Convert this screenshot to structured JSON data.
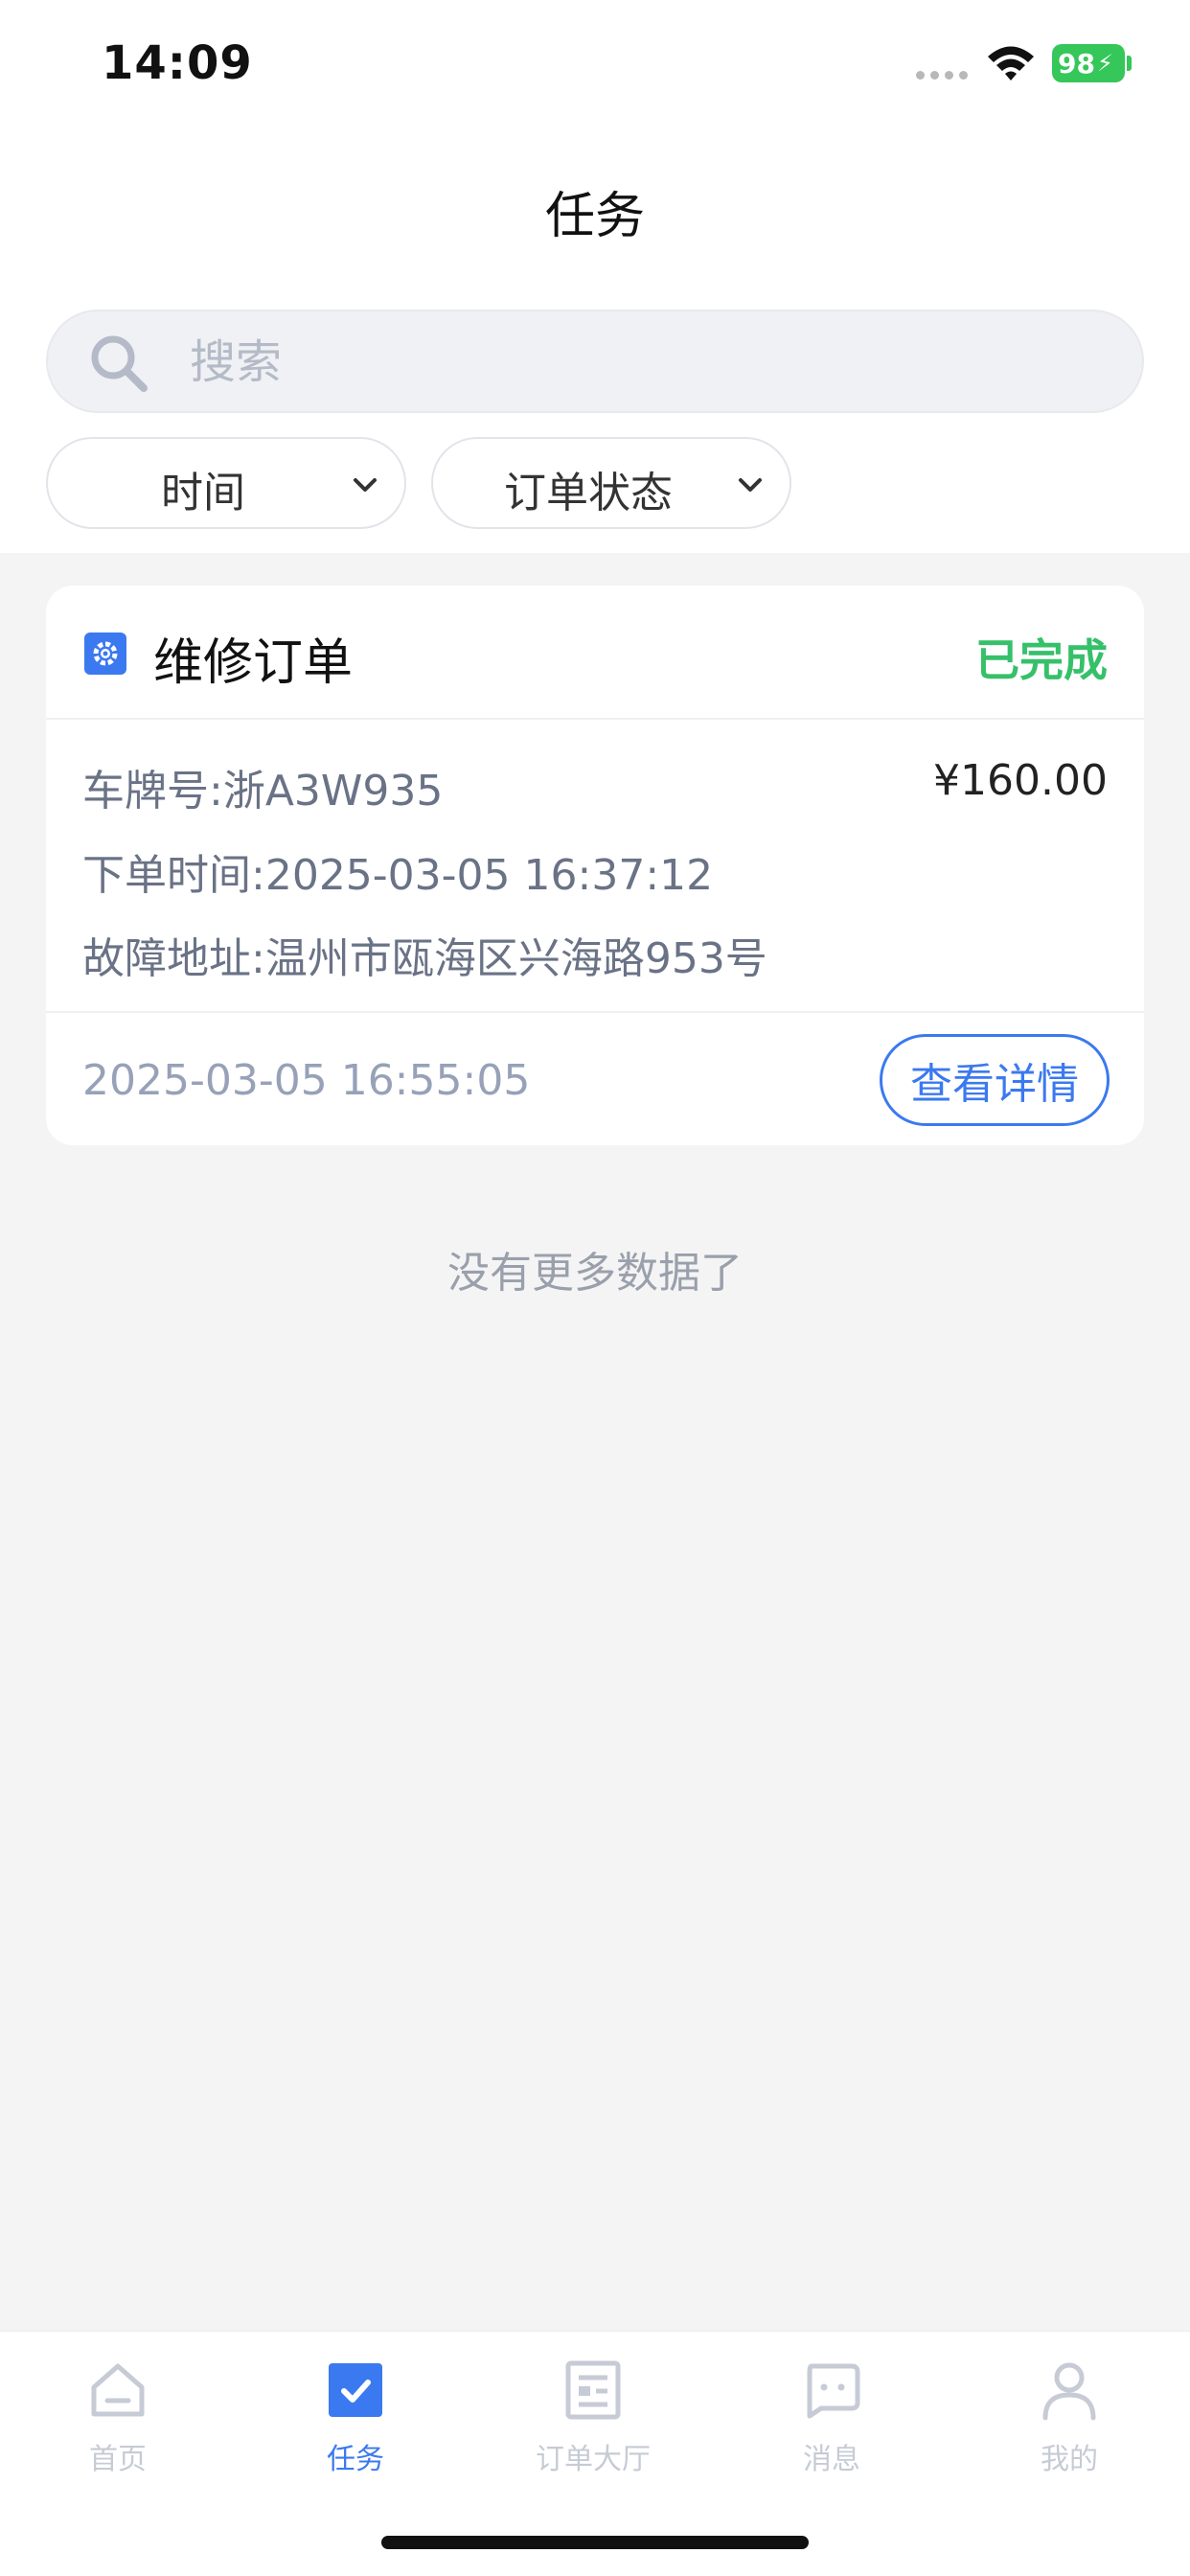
{
  "status_bar": {
    "time": "14:09",
    "battery": "98"
  },
  "header": {
    "title": "任务"
  },
  "search": {
    "placeholder": "搜索"
  },
  "filters": [
    {
      "label": "时间"
    },
    {
      "label": "订单状态"
    }
  ],
  "order": {
    "title": "维修订单",
    "status": "已完成",
    "plate_label": "车牌号:",
    "plate_value": "浙A3W935",
    "price": "¥160.00",
    "order_time_label": "下单时间:",
    "order_time_value": "2025-03-05 16:37:12",
    "address_label": "故障地址:",
    "address_value": "温州市瓯海区兴海路953号",
    "footer_time": "2025-03-05 16:55:05",
    "detail_button": "查看详情"
  },
  "no_more": "没有更多数据了",
  "tabs": [
    {
      "label": "首页",
      "icon": "home-icon"
    },
    {
      "label": "任务",
      "icon": "task-check-icon",
      "active": true
    },
    {
      "label": "订单大厅",
      "icon": "order-hall-icon"
    },
    {
      "label": "消息",
      "icon": "message-icon"
    },
    {
      "label": "我的",
      "icon": "profile-icon"
    }
  ],
  "colors": {
    "accent": "#3b79f0",
    "success": "#36c06a",
    "battery": "#35c759"
  }
}
